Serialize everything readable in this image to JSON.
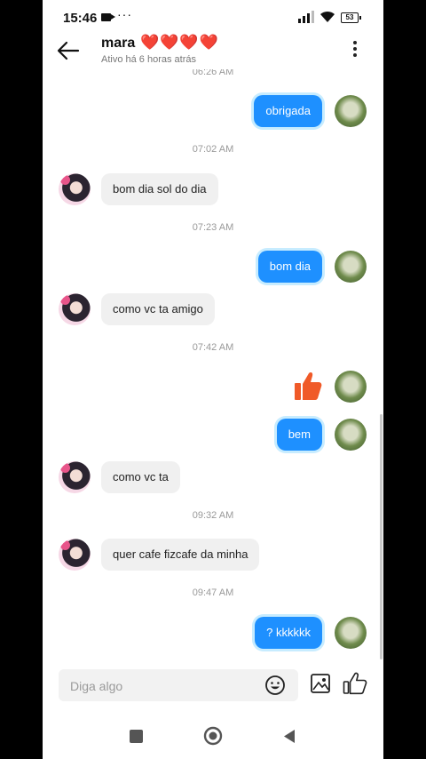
{
  "status_bar": {
    "time": "15:46",
    "extra": "···",
    "battery": "53"
  },
  "header": {
    "name": "mara",
    "hearts": "❤️❤️❤️❤️",
    "status": "Ativo há 6 horas atrás"
  },
  "messages": [
    {
      "kind": "timestamp",
      "text": "06:26 AM"
    },
    {
      "kind": "out",
      "text": "obrigada"
    },
    {
      "kind": "timestamp",
      "text": "07:02 AM"
    },
    {
      "kind": "in",
      "text": "bom dia sol do dia"
    },
    {
      "kind": "timestamp",
      "text": "07:23 AM"
    },
    {
      "kind": "out",
      "text": "bom dia"
    },
    {
      "kind": "in",
      "text": "como vc ta amigo"
    },
    {
      "kind": "timestamp",
      "text": "07:42 AM"
    },
    {
      "kind": "out-like",
      "icon": "thumbs-up-icon"
    },
    {
      "kind": "out",
      "text": "bem"
    },
    {
      "kind": "in",
      "text": "como vc ta"
    },
    {
      "kind": "timestamp",
      "text": "09:32 AM"
    },
    {
      "kind": "in",
      "text": "quer cafe fizcafe da minha"
    },
    {
      "kind": "timestamp",
      "text": "09:47 AM"
    },
    {
      "kind": "out",
      "text": "? kkkkkk"
    }
  ],
  "composer": {
    "placeholder": "Diga algo"
  },
  "colors": {
    "outgoing_bubble": "#1e90ff",
    "incoming_bubble": "#f0f0f0",
    "like_icon": "#f05a28",
    "hearts": "#e11d2a"
  }
}
